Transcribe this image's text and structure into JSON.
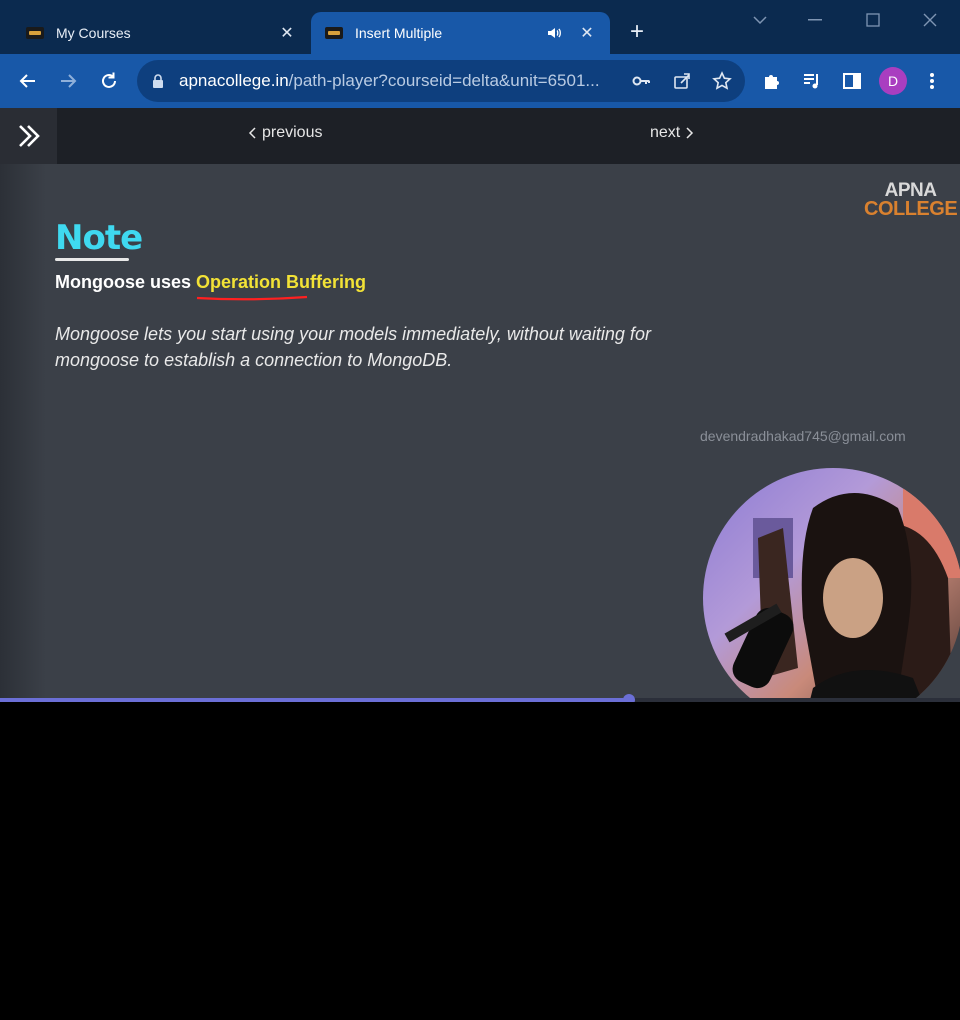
{
  "tabs": [
    {
      "title": "My Courses",
      "active": false
    },
    {
      "title": "Insert Multiple",
      "active": true
    }
  ],
  "address_bar": {
    "host": "apnacollege.in",
    "path": "/path-player?courseid=delta&unit=6501..."
  },
  "profile": {
    "initial": "D"
  },
  "player_nav": {
    "previous_label": "previous",
    "next_label": "next"
  },
  "slide": {
    "logo_line1": "APNA",
    "logo_line2": "COLLEGE",
    "heading": "Note",
    "subtitle_prefix": "Mongoose uses ",
    "subtitle_highlight": "Operation Buffering",
    "paragraph": "Mongoose lets you start using your models immediately, without waiting for mongoose to establish a connection to MongoDB.",
    "watermark": "devendradhakad745@gmail.com"
  },
  "progress": {
    "fraction": 0.655
  },
  "colors": {
    "heading": "#3fd9f0",
    "highlight": "#f2e236",
    "accent": "#6b6fd6",
    "tab_active": "#1858a8"
  }
}
